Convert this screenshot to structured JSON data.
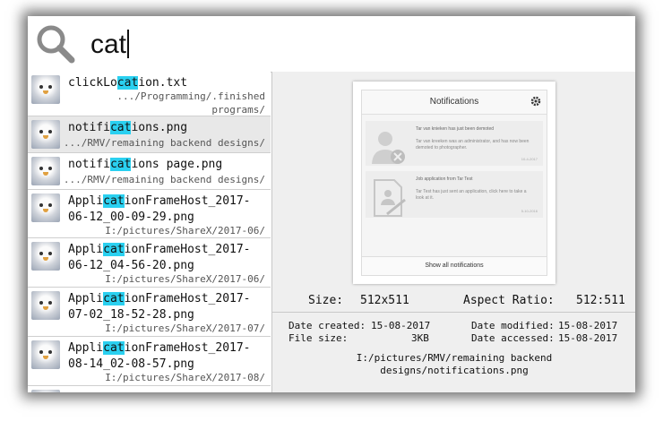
{
  "search": {
    "query": "cat"
  },
  "results": [
    {
      "pre": "clickLo",
      "hl": "cat",
      "post": "ion.txt",
      "path": "  .../Programming/.finished\nprograms/"
    },
    {
      "pre": "notifi",
      "hl": "cat",
      "post": "ions.png",
      "path": ".../RMV/remaining backend designs/"
    },
    {
      "pre": "notifi",
      "hl": "cat",
      "post": "ions page.png",
      "path": ".../RMV/remaining backend designs/"
    },
    {
      "pre": "Appli",
      "hl": "cat",
      "post": "ionFrameHost_2017-\n06-12_00-09-29.png",
      "path": "I:/pictures/ShareX/2017-06/"
    },
    {
      "pre": "Appli",
      "hl": "cat",
      "post": "ionFrameHost_2017-\n06-12_04-56-20.png",
      "path": "I:/pictures/ShareX/2017-06/"
    },
    {
      "pre": "Appli",
      "hl": "cat",
      "post": "ionFrameHost_2017-\n07-02_18-52-28.png",
      "path": "I:/pictures/ShareX/2017-07/"
    },
    {
      "pre": "Appli",
      "hl": "cat",
      "post": "ionFrameHost_2017-\n08-14_02-08-57.png",
      "path": "I:/pictures/ShareX/2017-08/"
    }
  ],
  "preview": {
    "image": {
      "title": "Notifications",
      "cards": [
        {
          "heading": "Tar van knieken has just been demoted",
          "body": "Tar van kreeken was an administrator, and has now been demoted to photographer.",
          "date": "10-4-2017"
        },
        {
          "heading": "Job application from Tar Test",
          "body": "Tar Test has just sent an application, click here to take a look at it.",
          "date": "5-10-2016"
        }
      ],
      "show_all": "Show all notifications"
    },
    "size_label": "Size:",
    "size_value": "512x511",
    "aspect_label": "Aspect Ratio:",
    "aspect_value": "512:511",
    "date_created_label": "Date created:",
    "date_created": "15-08-2017",
    "date_modified_label": "Date modified:",
    "date_modified": "15-08-2017",
    "file_size_label": "File size:",
    "file_size": "3KB",
    "date_accessed_label": "Date accessed:",
    "date_accessed": "15-08-2017",
    "full_path": "I:/pictures/RMV/remaining backend\ndesigns/notifications.png"
  },
  "colors": {
    "highlight": "#2ad0f0",
    "selected_row": "#e8e8e8"
  }
}
